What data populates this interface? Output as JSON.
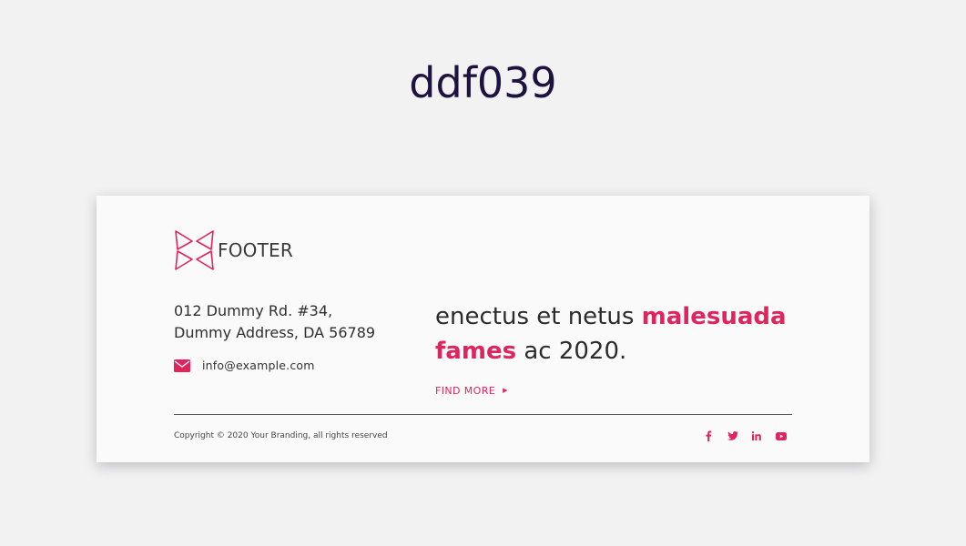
{
  "page": {
    "heading": "ddf039"
  },
  "footer": {
    "brand_name": "FOOTER",
    "logo_icon": "bowtie-triangles-logo",
    "address_line1": "012 Dummy Rd. #34,",
    "address_line2": "Dummy Address, DA 56789",
    "email": "info@example.com",
    "email_icon": "mail-icon",
    "tagline": {
      "part1": "enectus et netus ",
      "accent1": "malesuada",
      "accent2": "fames",
      "part2": " ac 2020."
    },
    "find_more_label": "FIND MORE",
    "find_more_arrow": "▶",
    "copyright": "Copyright © 2020 Your Branding, all rights reserved",
    "socials": [
      {
        "name": "facebook-icon"
      },
      {
        "name": "twitter-icon"
      },
      {
        "name": "linkedin-icon"
      },
      {
        "name": "youtube-icon"
      }
    ]
  },
  "colors": {
    "accent": "#e0245e",
    "heading": "#1d1340",
    "background": "#f2f2f3",
    "card": "#fafafa"
  }
}
